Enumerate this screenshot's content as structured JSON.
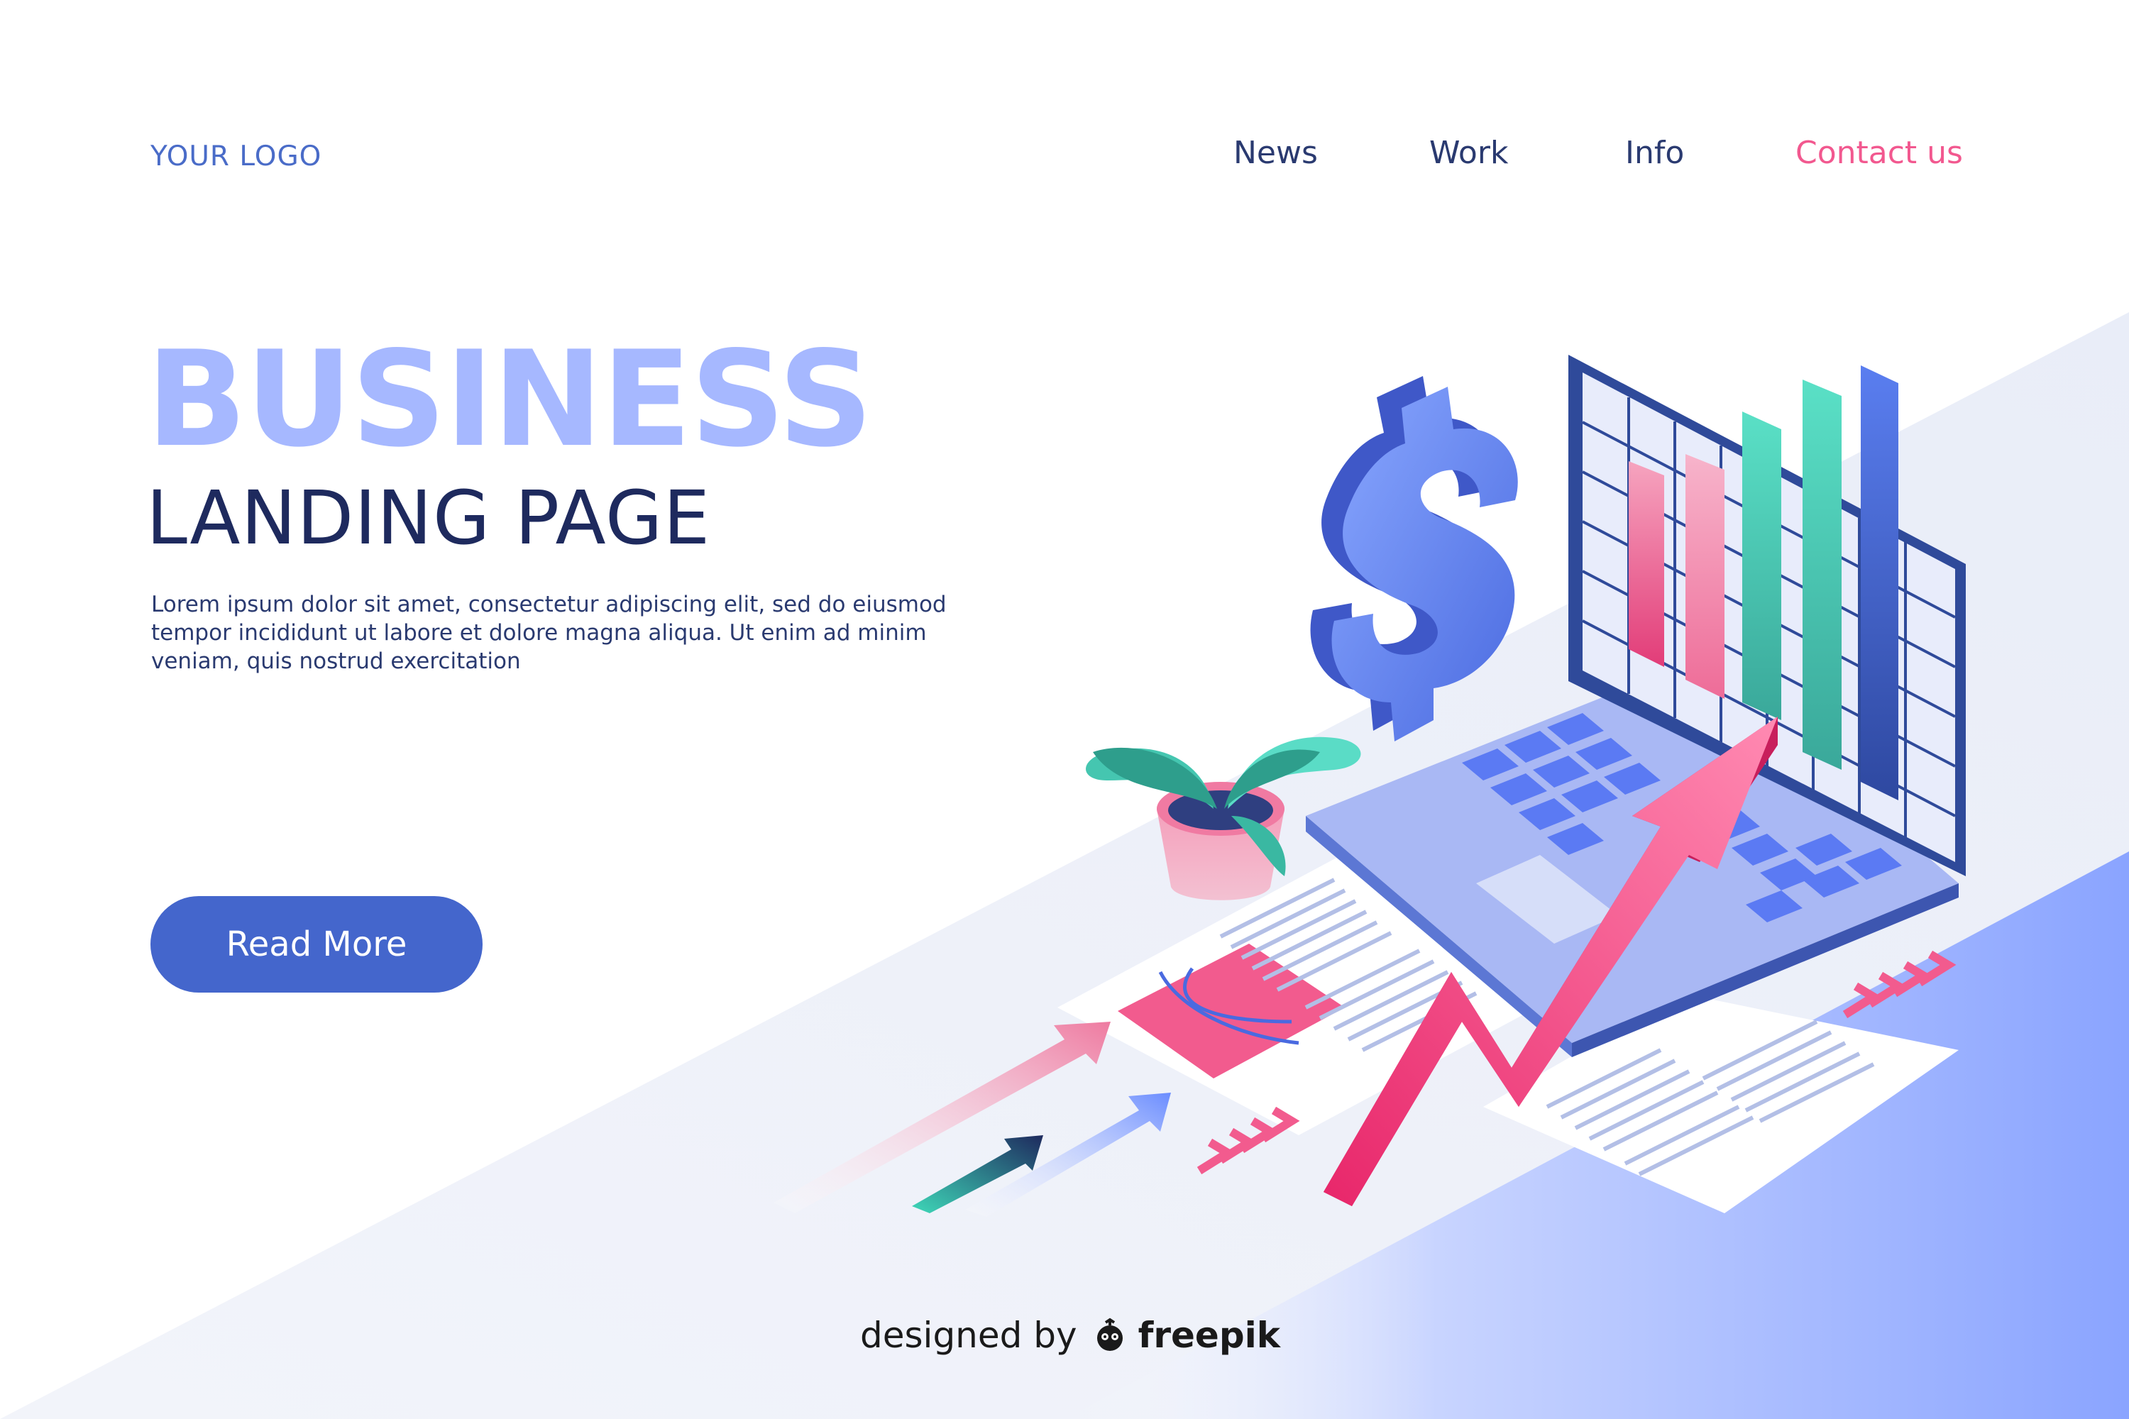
{
  "header": {
    "logo": "YOUR LOGO",
    "nav": [
      {
        "label": "News"
      },
      {
        "label": "Work"
      },
      {
        "label": "Info"
      },
      {
        "label": "Contact us"
      }
    ]
  },
  "hero": {
    "title": "BUSINESS",
    "subtitle": "LANDING PAGE",
    "text": "Lorem ipsum dolor sit amet, consectetur adipiscing elit, sed do eiusmod tempor incididunt ut labore et dolore magna aliqua. Ut enim ad minim veniam, quis nostrud exercitation",
    "button_label": "Read More"
  },
  "footer": {
    "credit_prefix": "designed by",
    "credit_brand": "freepik"
  },
  "colors": {
    "accent": "#4466cc",
    "title_light": "#a6b8ff",
    "dark_navy": "#1e2a5e",
    "pink": "#f2588f",
    "teal": "#5ad6c0"
  },
  "icons": [
    "dollar-icon",
    "laptop-icon",
    "plant-icon",
    "growth-arrow-icon",
    "freepik-logo-icon"
  ]
}
